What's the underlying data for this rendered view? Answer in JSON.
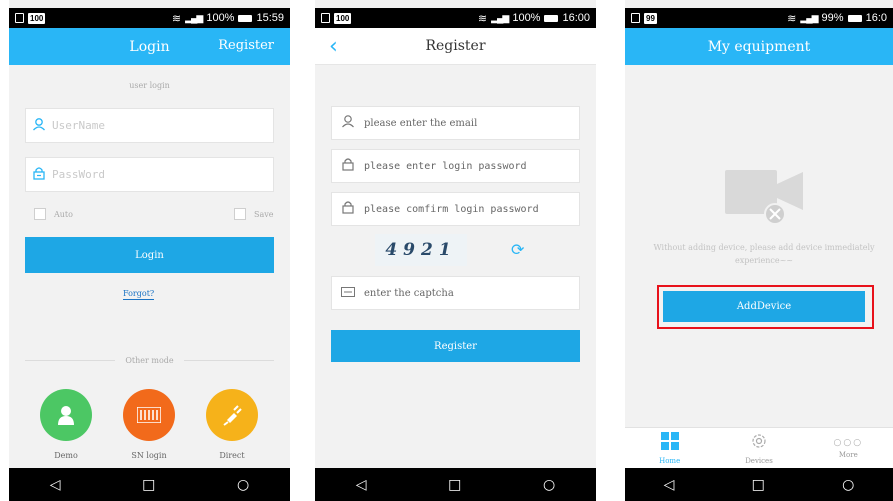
{
  "screens": {
    "login": {
      "status": {
        "badge": "100",
        "battery": "100%",
        "time": "15:59"
      },
      "title": "Login",
      "register_link": "Register",
      "caption": "user login",
      "username_placeholder": "UserName",
      "password_placeholder": "PassWord",
      "auto_label": "Auto",
      "save_label": "Save",
      "login_button": "Login",
      "forgot_link": "Forgot?",
      "other_mode": "Other mode",
      "modes": [
        {
          "label": "Demo",
          "color": "#4cc764",
          "icon": "person-icon"
        },
        {
          "label": "SN login",
          "color": "#f26a1b",
          "icon": "barcode-icon"
        },
        {
          "label": "Direct",
          "color": "#f6b21a",
          "icon": "plug-icon"
        }
      ]
    },
    "register": {
      "status": {
        "badge": "100",
        "battery": "100%",
        "time": "16:00"
      },
      "title": "Register",
      "email_placeholder": "please enter the email",
      "password_placeholder": "please enter login password",
      "confirm_placeholder": "please comfirm login password",
      "captcha_code": "4921",
      "captcha_placeholder": "enter the captcha",
      "register_button": "Register"
    },
    "equipment": {
      "status": {
        "badge": "99",
        "battery": "99%",
        "time": "16:0"
      },
      "title": "My equipment",
      "empty_message": "Without adding device, please add device immediately experience~~",
      "add_button": "AddDevice",
      "highlight_color": "#e8121b",
      "tabs": [
        {
          "label": "Home",
          "icon": "home-grid-icon",
          "active": true
        },
        {
          "label": "Devices",
          "icon": "gear-icon",
          "active": false
        },
        {
          "label": "More",
          "icon": "more-dots-icon",
          "active": false
        }
      ]
    }
  },
  "accent_color": "#29b6f6",
  "button_color": "#1ea7e5"
}
